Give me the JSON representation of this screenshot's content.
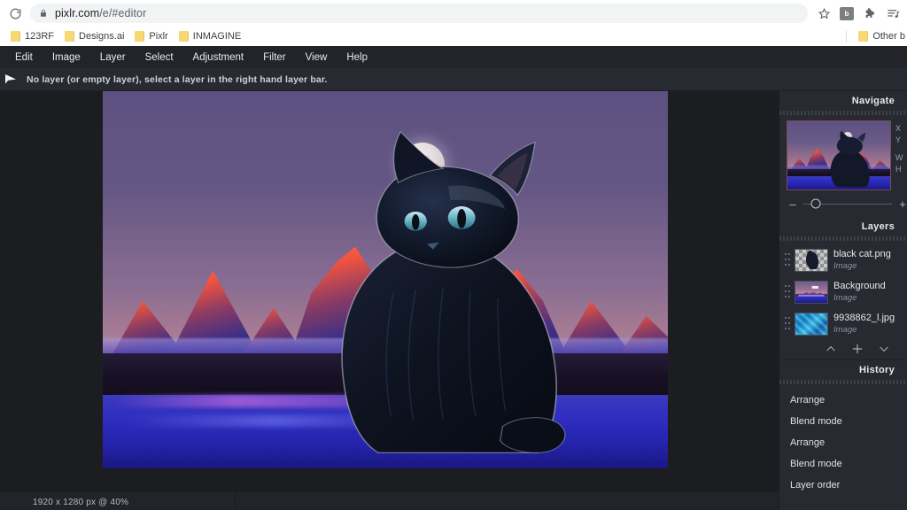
{
  "browser": {
    "reload_icon": "reload-icon",
    "lock_icon": "lock-icon",
    "url_host": "pixlr.com",
    "url_path": "/e/#editor",
    "url_full": "pixlr.com/e/#editor",
    "toolbar_icons": [
      {
        "name": "bookmark-star-icon",
        "glyph": "☆"
      },
      {
        "name": "extension-badge-icon",
        "glyph": "b"
      },
      {
        "name": "extensions-puzzle-icon",
        "glyph": "puzzle"
      },
      {
        "name": "reading-list-icon",
        "glyph": "list-music"
      }
    ],
    "bookmarks": [
      {
        "label": "123RF",
        "icon": "folder-icon"
      },
      {
        "label": "Designs.ai",
        "icon": "folder-icon"
      },
      {
        "label": "Pixlr",
        "icon": "folder-icon"
      },
      {
        "label": "INMAGINE",
        "icon": "folder-icon"
      }
    ],
    "other_bookmarks": {
      "label": "Other b",
      "icon": "folder-icon"
    }
  },
  "app": {
    "menu": [
      {
        "label": "Edit"
      },
      {
        "label": "Image"
      },
      {
        "label": "Layer"
      },
      {
        "label": "Select"
      },
      {
        "label": "Adjustment"
      },
      {
        "label": "Filter"
      },
      {
        "label": "View"
      },
      {
        "label": "Help"
      }
    ],
    "status": {
      "cursor_icon": "cursor-arrow-icon",
      "message": "No layer (or empty layer), select a layer in the right hand layer bar."
    },
    "canvas": {
      "dimensions": "1920 x 1280 px @ 40%",
      "artwork_description": "black cat silhouette in front of twilight alpenglow mountains with full moon"
    }
  },
  "navigate": {
    "title": "Navigate",
    "thumbnail_name": "navigate-thumbnail",
    "coords": [
      {
        "label": "X"
      },
      {
        "label": "Y"
      },
      {
        "label": "W"
      },
      {
        "label": "H"
      }
    ],
    "zoom_minus": "–",
    "zoom_plus": "+",
    "zoom_handle_percent": 14
  },
  "layers": {
    "title": "Layers",
    "items": [
      {
        "name": "black cat.png",
        "type": "Image",
        "thumb": "lt-cat"
      },
      {
        "name": "Background",
        "type": "Image",
        "thumb": "lt-bg"
      },
      {
        "name": "9938862_l.jpg",
        "type": "Image",
        "thumb": "lt-jpg"
      }
    ],
    "actions": [
      {
        "name": "layer-up-button",
        "glyph": "chevron-up"
      },
      {
        "name": "layer-add-button",
        "glyph": "plus"
      },
      {
        "name": "layer-down-button",
        "glyph": "chevron-down"
      }
    ]
  },
  "history": {
    "title": "History",
    "items": [
      {
        "label": "Arrange"
      },
      {
        "label": "Blend mode"
      },
      {
        "label": "Arrange"
      },
      {
        "label": "Blend mode"
      },
      {
        "label": "Layer order"
      }
    ]
  },
  "colors": {
    "panel_bg": "#272a31",
    "menubar_bg": "#22242a",
    "canvas_bg": "#1c1d21",
    "text_primary": "#e7e9ec",
    "text_muted": "#8b9099",
    "thumb_border": "#7a4a50"
  }
}
